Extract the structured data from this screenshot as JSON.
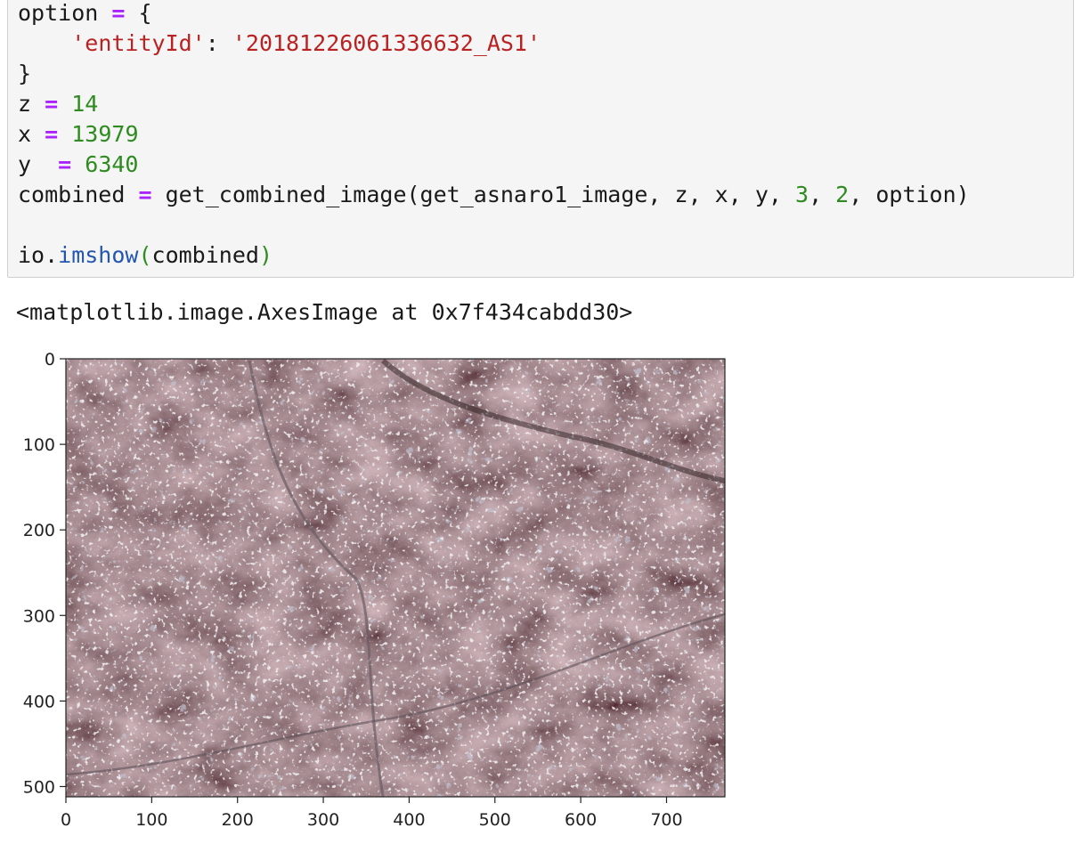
{
  "code": {
    "lines": [
      [
        {
          "t": "option "
        },
        {
          "t": "=",
          "c": "op"
        },
        {
          "t": " {"
        }
      ],
      [
        {
          "t": "    "
        },
        {
          "t": "'entityId'",
          "c": "str"
        },
        {
          "t": ": "
        },
        {
          "t": "'20181226061336632_AS1'",
          "c": "str"
        }
      ],
      [
        {
          "t": "}"
        }
      ],
      [
        {
          "t": "z "
        },
        {
          "t": "=",
          "c": "op"
        },
        {
          "t": " "
        },
        {
          "t": "14",
          "c": "num"
        }
      ],
      [
        {
          "t": "x "
        },
        {
          "t": "=",
          "c": "op"
        },
        {
          "t": " "
        },
        {
          "t": "13979",
          "c": "num"
        }
      ],
      [
        {
          "t": "y  "
        },
        {
          "t": "=",
          "c": "op"
        },
        {
          "t": " "
        },
        {
          "t": "6340",
          "c": "num"
        }
      ],
      [
        {
          "t": "combined "
        },
        {
          "t": "=",
          "c": "op"
        },
        {
          "t": " get_combined_image(get_asnaro1_image, z, x, y, "
        },
        {
          "t": "3",
          "c": "num"
        },
        {
          "t": ", "
        },
        {
          "t": "2",
          "c": "num"
        },
        {
          "t": ", option)"
        }
      ],
      [
        {
          "t": ""
        }
      ],
      [
        {
          "t": "io."
        },
        {
          "t": "imshow",
          "c": "fn"
        },
        {
          "t": "(",
          "c": "paren"
        },
        {
          "t": "combined"
        },
        {
          "t": ")",
          "c": "paren"
        }
      ]
    ]
  },
  "output": {
    "text": "<matplotlib.image.AxesImage at 0x7f434cabdd30>"
  },
  "plot": {
    "xlim": [
      0,
      768
    ],
    "ylim": [
      0,
      512
    ],
    "xticks": [
      0,
      100,
      200,
      300,
      400,
      500,
      600,
      700
    ],
    "yticks": [
      0,
      100,
      200,
      300,
      400,
      500
    ],
    "image_content": "satellite-image"
  },
  "colors": {
    "terrain_dark": "#3a2a2c",
    "terrain_mid": "#5a4446",
    "terrain_light": "#7a6466",
    "snow": "#d8d4d6",
    "urban": "#8a8ca0"
  }
}
